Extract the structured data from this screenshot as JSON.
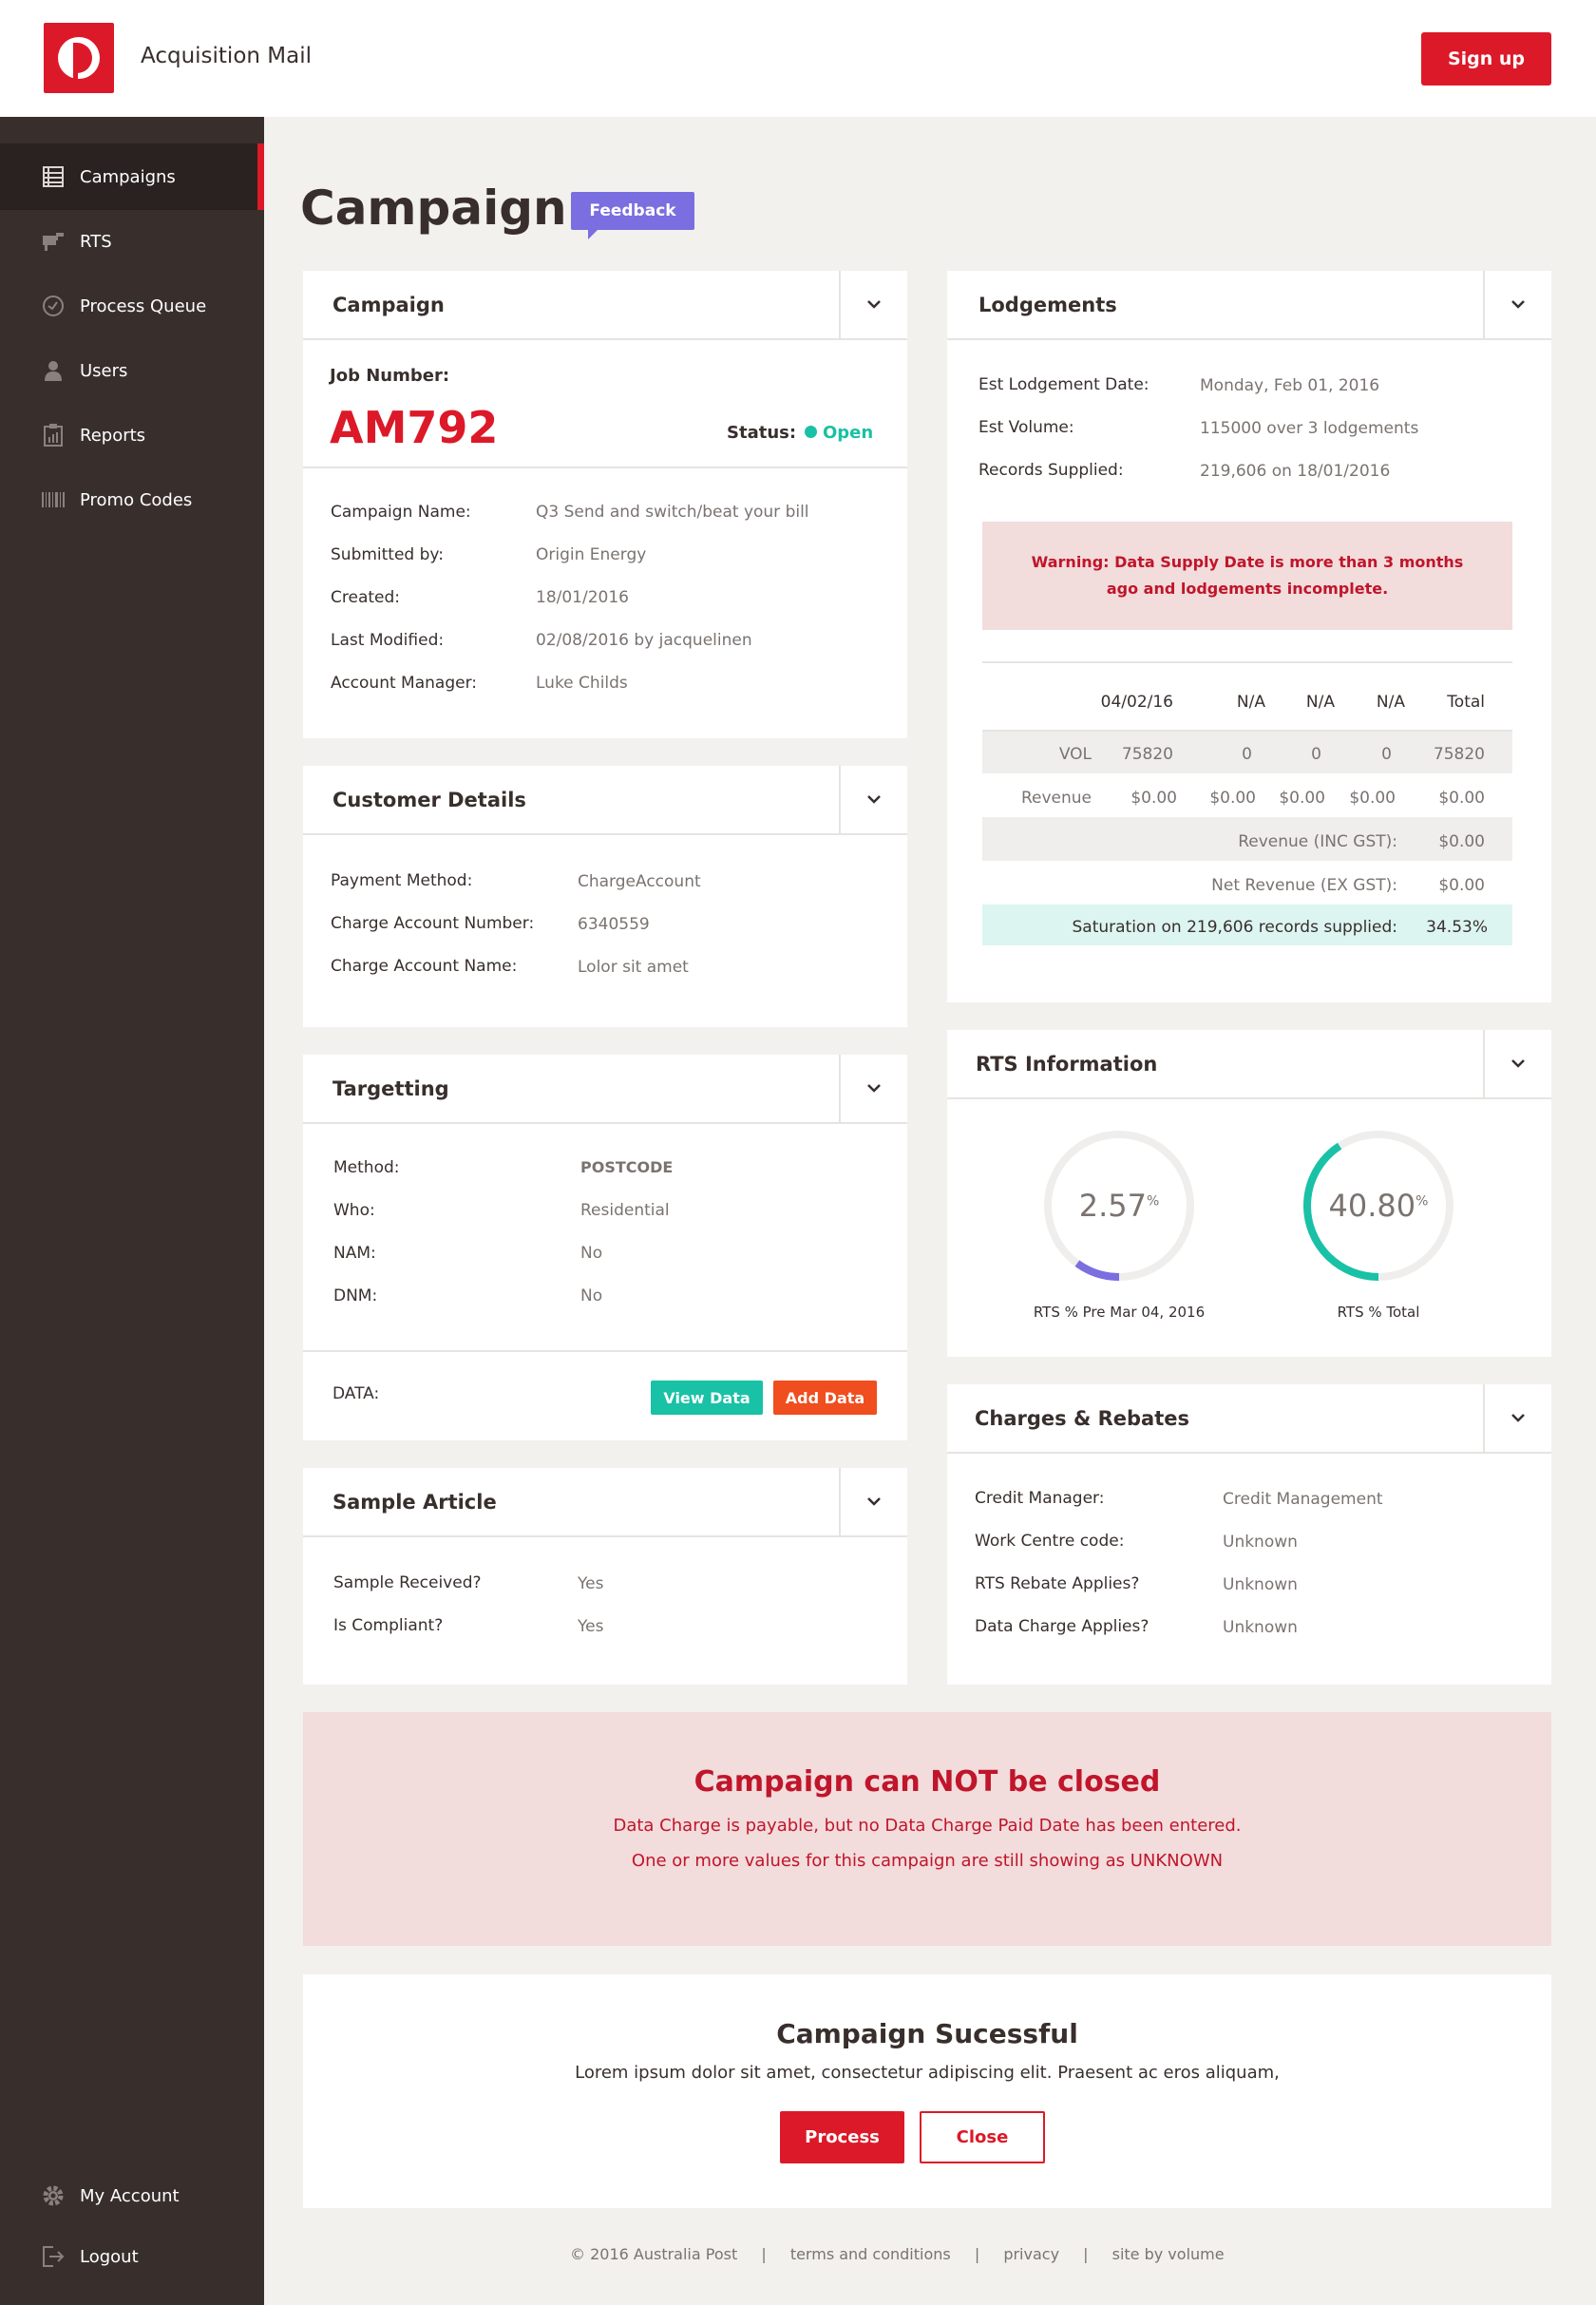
{
  "header": {
    "app_title": "Acquisition Mail",
    "signup_label": "Sign up"
  },
  "sidebar": {
    "items": [
      {
        "label": "Campaigns",
        "icon": "list-icon"
      },
      {
        "label": "RTS",
        "icon": "mailbox-icon"
      },
      {
        "label": "Process Queue",
        "icon": "clock-icon"
      },
      {
        "label": "Users",
        "icon": "user-icon"
      },
      {
        "label": "Reports",
        "icon": "report-icon"
      },
      {
        "label": "Promo Codes",
        "icon": "barcode-icon"
      }
    ],
    "bottom": [
      {
        "label": "My Account",
        "icon": "gear-icon"
      },
      {
        "label": "Logout",
        "icon": "logout-icon"
      }
    ]
  },
  "page": {
    "title": "Campaign",
    "feedback_label": "Feedback"
  },
  "campaign": {
    "title": "Campaign",
    "job_label": "Job Number:",
    "job_number": "AM792",
    "status_label": "Status:",
    "status_value": "Open",
    "fields": [
      {
        "label": "Campaign Name:",
        "value": "Q3 Send and switch/beat your bill"
      },
      {
        "label": "Submitted by:",
        "value": "Origin Energy"
      },
      {
        "label": "Created:",
        "value": "18/01/2016"
      },
      {
        "label": "Last Modified:",
        "value": "02/08/2016 by jacquelinen"
      },
      {
        "label": "Account Manager:",
        "value": "Luke Childs"
      }
    ]
  },
  "customer": {
    "title": "Customer Details",
    "fields": [
      {
        "label": "Payment Method:",
        "value": "ChargeAccount"
      },
      {
        "label": "Charge Account Number:",
        "value": "6340559"
      },
      {
        "label": "Charge Account Name:",
        "value": "Lolor sit amet"
      }
    ]
  },
  "targetting": {
    "title": "Targetting",
    "fields": [
      {
        "label": "Method:",
        "value": "POSTCODE"
      },
      {
        "label": "Who:",
        "value": "Residential"
      },
      {
        "label": "NAM:",
        "value": "No"
      },
      {
        "label": "DNM:",
        "value": "No"
      }
    ],
    "data_label": "DATA:",
    "view_data": "View Data",
    "add_data": "Add Data"
  },
  "sample": {
    "title": "Sample Article",
    "fields": [
      {
        "label": "Sample Received?",
        "value": "Yes"
      },
      {
        "label": "Is Compliant?",
        "value": "Yes"
      }
    ]
  },
  "lodgements": {
    "title": "Lodgements",
    "fields": [
      {
        "label": "Est Lodgement Date:",
        "value": "Monday, Feb 01, 2016"
      },
      {
        "label": "Est Volume:",
        "value": "115000 over 3 lodgements"
      },
      {
        "label": "Records Supplied:",
        "value": "219,606 on 18/01/2016"
      }
    ],
    "warning_line1": "Warning: Data Supply Date is more than 3 months",
    "warning_line2": "ago and lodgements incomplete.",
    "table": {
      "headers": [
        "04/02/16",
        "N/A",
        "N/A",
        "N/A",
        "Total"
      ],
      "vol_label": "VOL",
      "vol": [
        "75820",
        "0",
        "0",
        "0",
        "75820"
      ],
      "rev_label": "Revenue",
      "rev": [
        "$0.00",
        "$0.00",
        "$0.00",
        "$0.00",
        "$0.00"
      ],
      "rev_inc_label": "Revenue (INC GST):",
      "rev_inc": "$0.00",
      "net_label": "Net Revenue (EX GST):",
      "net": "$0.00",
      "sat_label": "Saturation on 219,606 records supplied:",
      "sat": "34.53%"
    }
  },
  "rts": {
    "title": "RTS Information",
    "g1": {
      "value": "2.57",
      "unit": "%",
      "label": "RTS % Pre Mar 04, 2016",
      "fraction": 0.0257,
      "color": "#7a6ee0"
    },
    "g2": {
      "value": "40.80",
      "unit": "%",
      "label": "RTS % Total",
      "fraction": 0.408,
      "color": "#19c1a6"
    }
  },
  "charges": {
    "title": "Charges & Rebates",
    "fields": [
      {
        "label": "Credit Manager:",
        "value": "Credit Management"
      },
      {
        "label": "Work Centre code:",
        "value": "Unknown"
      },
      {
        "label": "RTS Rebate Applies?",
        "value": "Unknown"
      },
      {
        "label": "Data Charge Applies?",
        "value": "Unknown"
      }
    ]
  },
  "close_warning": {
    "title": "Campaign can NOT be closed",
    "line1": "Data Charge is payable, but no Data Charge Paid Date has been entered.",
    "line2": "One or more values for this campaign are still showing as UNKNOWN"
  },
  "success": {
    "title": "Campaign Sucessful",
    "text": "Lorem ipsum dolor sit amet, consectetur adipiscing elit. Praesent ac eros aliquam,",
    "process": "Process",
    "close": "Close"
  },
  "footer": {
    "copyright": "© 2016 Australia Post",
    "sep": "|",
    "terms": "terms and conditions",
    "privacy": "privacy",
    "site": "site by volume"
  },
  "colors": {
    "brand": "#dc1928",
    "sidebar": "#382f2d",
    "accent_purple": "#7a6ee0",
    "accent_teal": "#19c1a6",
    "warn_bg": "#f2dcdc",
    "orange": "#f04e1e"
  }
}
